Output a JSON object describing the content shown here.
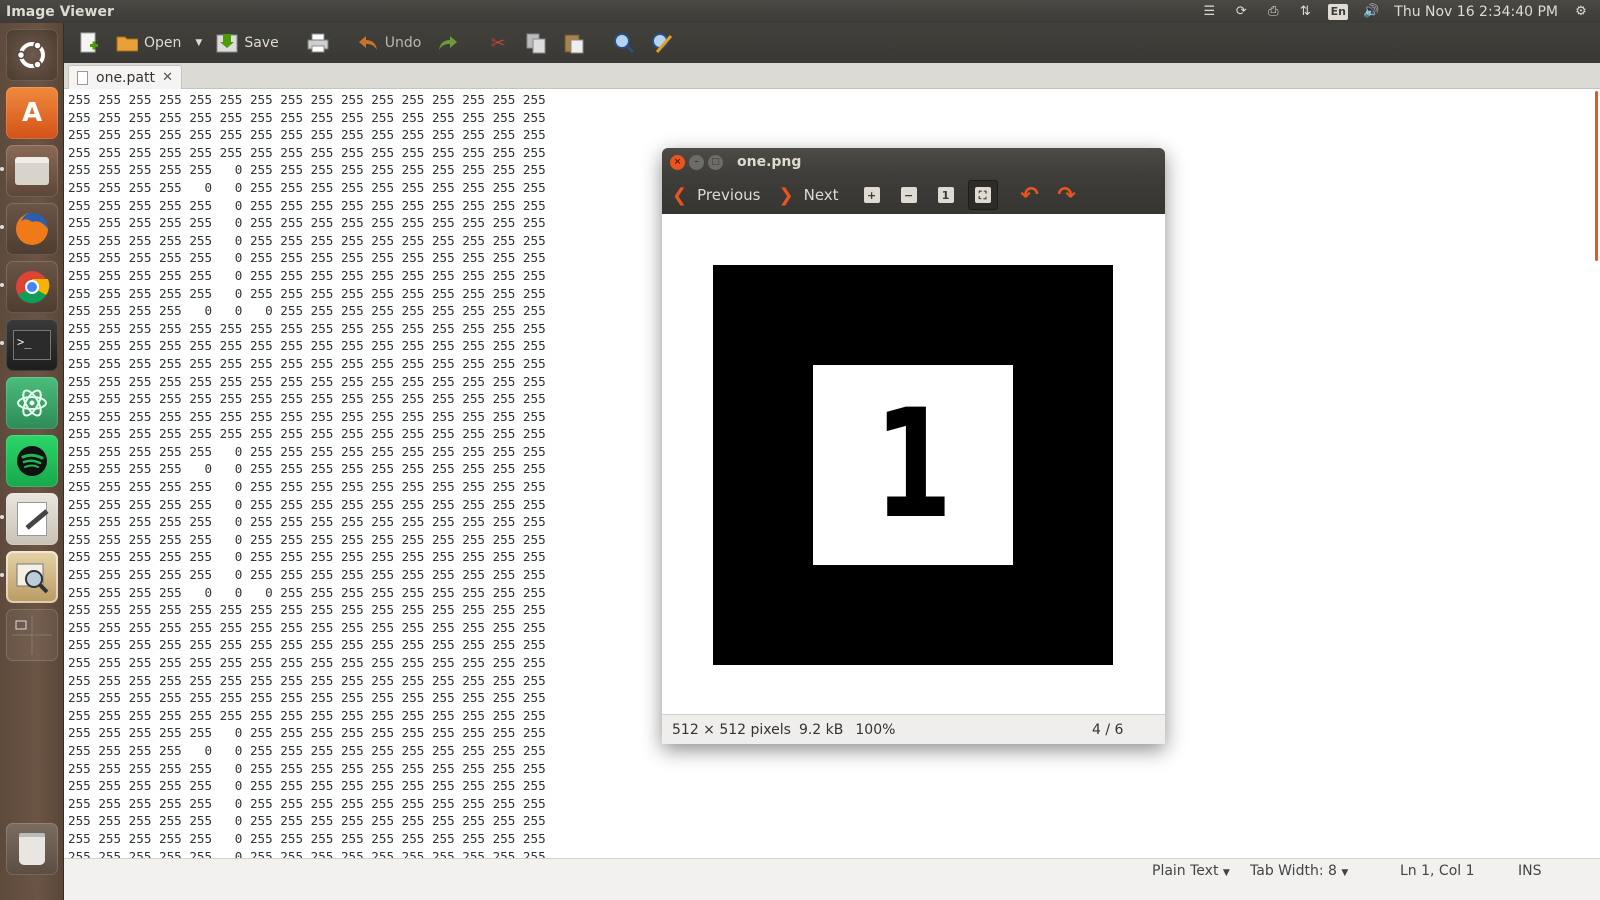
{
  "top_panel": {
    "app_title": "Image Viewer",
    "keyboard_indicator": "En",
    "clock": "Thu Nov 16  2:34:40 PM"
  },
  "launcher": {
    "items": [
      {
        "name": "ubuntu-dash-icon",
        "color": "#dd4814"
      },
      {
        "name": "software-center-icon",
        "color": "#e0631b"
      },
      {
        "name": "files-icon",
        "color": "#6d4c41"
      },
      {
        "name": "firefox-icon",
        "color": "#e66000"
      },
      {
        "name": "chrome-icon",
        "color": "#4285f4"
      },
      {
        "name": "terminal-icon",
        "color": "#2c2c2c"
      },
      {
        "name": "atom-icon",
        "color": "#3aa46a"
      },
      {
        "name": "spotify-icon",
        "color": "#1db954"
      },
      {
        "name": "text-editor-icon",
        "color": "#e8e4dc"
      },
      {
        "name": "image-viewer-icon",
        "color": "#d9c7a2"
      },
      {
        "name": "workspace-switcher-icon",
        "color": "#5b4a3e"
      },
      {
        "name": "trash-icon",
        "color": "#8a7d72"
      }
    ]
  },
  "toolbar": {
    "open_label": "Open",
    "save_label": "Save",
    "undo_label": "Undo"
  },
  "tab": {
    "title": "one.patt",
    "close": "✕"
  },
  "editor": {
    "lines": [
      "255 255 255 255 255 255 255 255 255 255 255 255 255 255 255 255",
      "255 255 255 255 255 255 255 255 255 255 255 255 255 255 255 255",
      "255 255 255 255 255 255 255 255 255 255 255 255 255 255 255 255",
      "255 255 255 255 255 255 255 255 255 255 255 255 255 255 255 255",
      "255 255 255 255 255   0 255 255 255 255 255 255 255 255 255 255",
      "255 255 255 255   0   0 255 255 255 255 255 255 255 255 255 255",
      "255 255 255 255 255   0 255 255 255 255 255 255 255 255 255 255",
      "255 255 255 255 255   0 255 255 255 255 255 255 255 255 255 255",
      "255 255 255 255 255   0 255 255 255 255 255 255 255 255 255 255",
      "255 255 255 255 255   0 255 255 255 255 255 255 255 255 255 255",
      "255 255 255 255 255   0 255 255 255 255 255 255 255 255 255 255",
      "255 255 255 255 255   0 255 255 255 255 255 255 255 255 255 255",
      "255 255 255 255   0   0   0 255 255 255 255 255 255 255 255 255",
      "255 255 255 255 255 255 255 255 255 255 255 255 255 255 255 255",
      "255 255 255 255 255 255 255 255 255 255 255 255 255 255 255 255",
      "255 255 255 255 255 255 255 255 255 255 255 255 255 255 255 255",
      "255 255 255 255 255 255 255 255 255 255 255 255 255 255 255 255",
      "255 255 255 255 255 255 255 255 255 255 255 255 255 255 255 255",
      "255 255 255 255 255 255 255 255 255 255 255 255 255 255 255 255",
      "255 255 255 255 255 255 255 255 255 255 255 255 255 255 255 255",
      "255 255 255 255 255   0 255 255 255 255 255 255 255 255 255 255",
      "255 255 255 255   0   0 255 255 255 255 255 255 255 255 255 255",
      "255 255 255 255 255   0 255 255 255 255 255 255 255 255 255 255",
      "255 255 255 255 255   0 255 255 255 255 255 255 255 255 255 255",
      "255 255 255 255 255   0 255 255 255 255 255 255 255 255 255 255",
      "255 255 255 255 255   0 255 255 255 255 255 255 255 255 255 255",
      "255 255 255 255 255   0 255 255 255 255 255 255 255 255 255 255",
      "255 255 255 255 255   0 255 255 255 255 255 255 255 255 255 255",
      "255 255 255 255   0   0   0 255 255 255 255 255 255 255 255 255",
      "255 255 255 255 255 255 255 255 255 255 255 255 255 255 255 255",
      "255 255 255 255 255 255 255 255 255 255 255 255 255 255 255 255",
      "255 255 255 255 255 255 255 255 255 255 255 255 255 255 255 255",
      "255 255 255 255 255 255 255 255 255 255 255 255 255 255 255 255",
      "255 255 255 255 255 255 255 255 255 255 255 255 255 255 255 255",
      "255 255 255 255 255 255 255 255 255 255 255 255 255 255 255 255",
      "255 255 255 255 255 255 255 255 255 255 255 255 255 255 255 255",
      "255 255 255 255 255   0 255 255 255 255 255 255 255 255 255 255",
      "255 255 255 255   0   0 255 255 255 255 255 255 255 255 255 255",
      "255 255 255 255 255   0 255 255 255 255 255 255 255 255 255 255",
      "255 255 255 255 255   0 255 255 255 255 255 255 255 255 255 255",
      "255 255 255 255 255   0 255 255 255 255 255 255 255 255 255 255",
      "255 255 255 255 255   0 255 255 255 255 255 255 255 255 255 255",
      "255 255 255 255 255   0 255 255 255 255 255 255 255 255 255 255",
      "255 255 255 255 255   0 255 255 255 255 255 255 255 255 255 255"
    ]
  },
  "statusbar": {
    "language": "Plain Text",
    "tab_width": "Tab Width: 8",
    "cursor": "Ln 1, Col 1",
    "mode": "INS"
  },
  "viewer": {
    "title": "one.png",
    "previous_label": "Previous",
    "next_label": "Next",
    "image_digit": "1",
    "dimensions": "512 × 512 pixels",
    "file_size": "9.2 kB",
    "zoom": "100%",
    "position": "4 / 6"
  },
  "colors": {
    "accent": "#e95420",
    "panel": "#3c3b37"
  }
}
